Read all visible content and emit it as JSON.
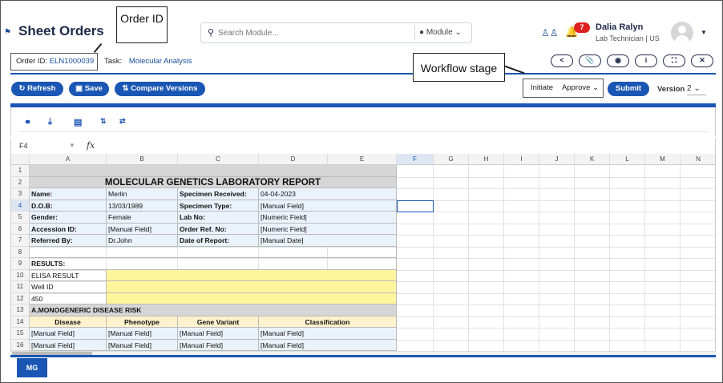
{
  "header": {
    "title": "Sheet Orders",
    "search_placeholder": "Search Module...",
    "module_label": "Module",
    "notifications_count": "7",
    "user_name": "Dalia Ralyn",
    "user_role": "Lab Technician | US"
  },
  "callouts": {
    "order_id": "Order ID",
    "workflow": "Workflow stage"
  },
  "order": {
    "id_label": "Order ID:",
    "id_value": "ELN1000039",
    "task_label": "Task:",
    "task_value": "Molecular Analysis"
  },
  "actions": {
    "refresh": "Refresh",
    "save": "Save",
    "compare": "Compare Versions",
    "initiate": "Initiate",
    "approve": "Approve",
    "submit": "Submit",
    "version_label": "Version",
    "version_value": "2"
  },
  "formula_bar": {
    "cell_ref": "F4",
    "fx": "fx"
  },
  "columns": [
    "A",
    "B",
    "C",
    "D",
    "E",
    "F",
    "G",
    "H",
    "I",
    "J",
    "K",
    "L",
    "M",
    "N"
  ],
  "rows": [
    "1",
    "2",
    "3",
    "4",
    "5",
    "6",
    "7",
    "8",
    "9",
    "10",
    "11",
    "12",
    "13",
    "14",
    "15",
    "16"
  ],
  "sheet": {
    "title": "MOLECULAR GENETICS LABORATORY REPORT",
    "r3": [
      "Name:",
      "Merlin",
      "Specimen Received:",
      "04-04-2023"
    ],
    "r4": [
      "D.O.B:",
      "13/03/1989",
      "Specimen Type:",
      "[Manual Field]"
    ],
    "r5": [
      "Gender:",
      "Female",
      "Lab No:",
      "[Numeric Field]"
    ],
    "r6": [
      "Accession ID:",
      "[Manual Field]",
      "Order Ref. No:",
      "[Numeric Field]"
    ],
    "r7": [
      "Referred By:",
      "Dr.John",
      "Date of Report:",
      "[Manual Date]"
    ],
    "r9": "RESULTS:",
    "r10": "ELISA RESULT",
    "r11": "Well ID",
    "r12": "450",
    "r13": "A.MONOGENERIC DISEASE RISK",
    "r14": [
      "Disease",
      "Phenotype",
      "Gene Variant",
      "Classification"
    ],
    "r15": [
      "[Manual Field]",
      "[Manual Field]",
      "[Manual Field]",
      "[Manual Field]"
    ],
    "r16": [
      "[Manual Field]",
      "[Manual Field]",
      "[Manual Field]",
      "[Manual Field]"
    ]
  },
  "bottom_tab": "MG",
  "colors": {
    "primary": "#1a56b4",
    "badge": "#e02020",
    "yellow": "#fff59d",
    "light_blue": "#eaf2fb"
  }
}
